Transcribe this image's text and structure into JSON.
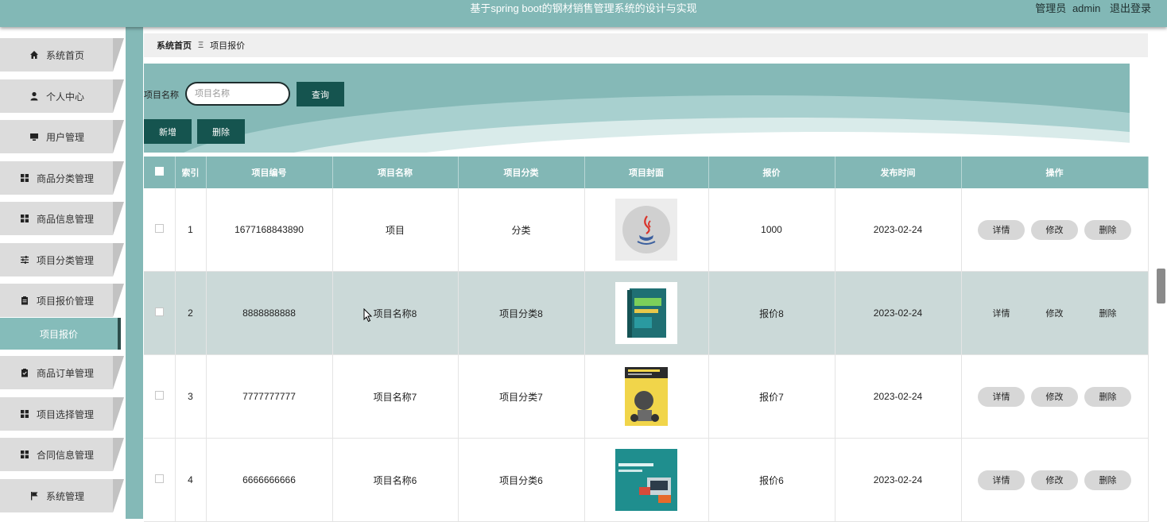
{
  "header": {
    "title": "基于spring boot的钢材销售管理系统的设计与实现",
    "role": "管理员",
    "username": "admin",
    "logout": "退出登录"
  },
  "sidebar": {
    "items": [
      {
        "label": "系统首页",
        "icon": "home-icon"
      },
      {
        "label": "个人中心",
        "icon": "user-icon"
      },
      {
        "label": "用户管理",
        "icon": "monitor-icon"
      },
      {
        "label": "商品分类管理",
        "icon": "grid-icon"
      },
      {
        "label": "商品信息管理",
        "icon": "grid-icon"
      },
      {
        "label": "项目分类管理",
        "icon": "sliders-icon"
      },
      {
        "label": "项目报价管理",
        "icon": "clipboard-icon"
      },
      {
        "label": "项目报价",
        "icon": "",
        "active": true
      },
      {
        "label": "商品订单管理",
        "icon": "clipboard-check-icon"
      },
      {
        "label": "项目选择管理",
        "icon": "grid-icon"
      },
      {
        "label": "合同信息管理",
        "icon": "grid-icon"
      },
      {
        "label": "系统管理",
        "icon": "flag-icon"
      }
    ]
  },
  "breadcrumb": {
    "home": "系统首页",
    "separator": "Ξ",
    "current": "项目报价"
  },
  "search": {
    "label": "项目名称",
    "placeholder": "项目名称",
    "value": "",
    "button": "查询"
  },
  "actions": {
    "add": "新增",
    "delete": "删除"
  },
  "table": {
    "columns": [
      "索引",
      "项目编号",
      "项目名称",
      "项目分类",
      "项目封面",
      "报价",
      "发布时间",
      "操作"
    ],
    "rows": [
      {
        "index": "1",
        "code": "1677168843890",
        "name": "项目",
        "category": "分类",
        "cover": "java-logo",
        "price": "1000",
        "date": "2023-02-24"
      },
      {
        "index": "2",
        "code": "8888888888",
        "name": "项目名称8",
        "category": "项目分类8",
        "cover": "book-cover-teal",
        "price": "报价8",
        "date": "2023-02-24"
      },
      {
        "index": "3",
        "code": "7777777777",
        "name": "项目名称7",
        "category": "项目分类7",
        "cover": "book-cover-python",
        "price": "报价7",
        "date": "2023-02-24"
      },
      {
        "index": "4",
        "code": "6666666666",
        "name": "项目名称6",
        "category": "项目分类6",
        "cover": "book-cover-scratch",
        "price": "报价6",
        "date": "2023-02-24"
      }
    ],
    "ops": {
      "detail": "详情",
      "edit": "修改",
      "delete": "删除"
    }
  },
  "colors": {
    "header": "#82b8b6",
    "accent_dark": "#15544f",
    "table_header": "#82b7b5",
    "row_highlight": "#cbd9d8"
  }
}
